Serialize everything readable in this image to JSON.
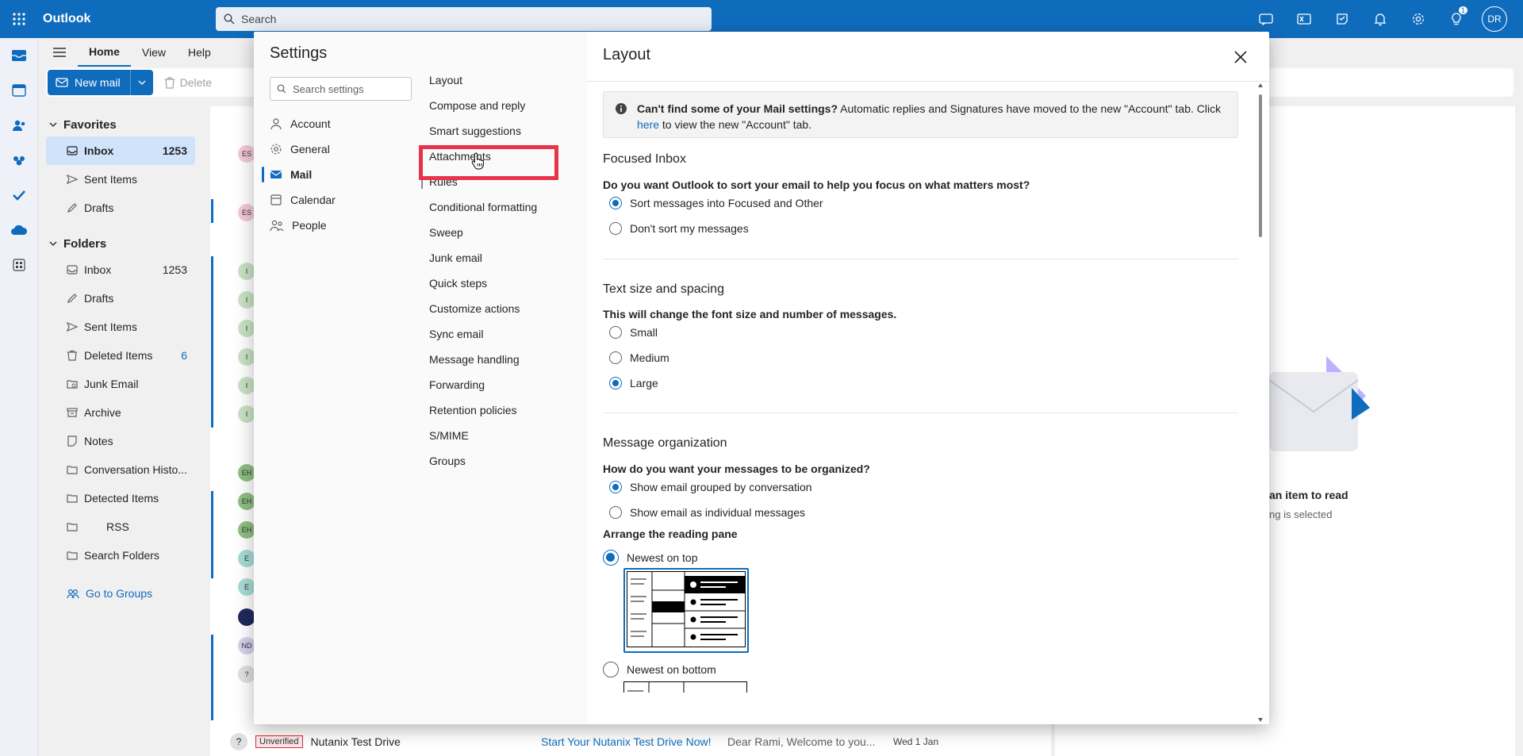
{
  "app": {
    "title": "Outlook",
    "search_placeholder": "Search",
    "user_initials": "DR",
    "tips_badge": "1"
  },
  "ribbon": {
    "tabs": [
      "Home",
      "View",
      "Help"
    ],
    "new_mail": "New mail",
    "delete": "Delete"
  },
  "folders": {
    "favorites_label": "Favorites",
    "favorites": [
      {
        "label": "Inbox",
        "count": "1253"
      },
      {
        "label": "Sent Items",
        "count": ""
      },
      {
        "label": "Drafts",
        "count": ""
      }
    ],
    "folders_label": "Folders",
    "items": [
      {
        "label": "Inbox",
        "count": "1253"
      },
      {
        "label": "Drafts",
        "count": ""
      },
      {
        "label": "Sent Items",
        "count": ""
      },
      {
        "label": "Deleted Items",
        "count": "6"
      },
      {
        "label": "Junk Email",
        "count": ""
      },
      {
        "label": "Archive",
        "count": ""
      },
      {
        "label": "Notes",
        "count": ""
      },
      {
        "label": "Conversation Histo...",
        "count": ""
      },
      {
        "label": "Detected Items",
        "count": ""
      },
      {
        "label": "RSS",
        "count": ""
      },
      {
        "label": "Search Folders",
        "count": ""
      }
    ],
    "go_to_groups": "Go to Groups"
  },
  "message_list": {
    "avatars": [
      "ES",
      "ES",
      "I",
      "I",
      "I",
      "I",
      "I",
      "I",
      "EH",
      "EH",
      "EH",
      "E",
      "E",
      "",
      "ND",
      "?",
      "?"
    ],
    "last_row": {
      "badge": "Unverified",
      "sender": "Nutanix Test Drive",
      "subject": "Start Your Nutanix Test Drive Now!",
      "preview": "Dear Rami, Welcome to you...",
      "date": "Wed 1 Jan"
    }
  },
  "reading_pane": {
    "title_partial": "an item to read",
    "subtitle_partial": "ng is selected"
  },
  "settings": {
    "title": "Settings",
    "search_placeholder": "Search settings",
    "categories": [
      {
        "label": "Account",
        "icon": "person-icon"
      },
      {
        "label": "General",
        "icon": "gear-icon"
      },
      {
        "label": "Mail",
        "icon": "mail-icon"
      },
      {
        "label": "Calendar",
        "icon": "calendar-icon"
      },
      {
        "label": "People",
        "icon": "people-icon"
      }
    ],
    "active_category": "Mail",
    "mail_subsections": [
      "Layout",
      "Compose and reply",
      "Smart suggestions",
      "Attachments",
      "Rules",
      "Conditional formatting",
      "Sweep",
      "Junk email",
      "Quick steps",
      "Customize actions",
      "Sync email",
      "Message handling",
      "Forwarding",
      "Retention policies",
      "S/MIME",
      "Groups"
    ],
    "active_subsection": "Rules",
    "content": {
      "header": "Layout",
      "info": {
        "bold": "Can't find some of your Mail settings?",
        "text": " Automatic replies and Signatures have moved to the new \"Account\" tab. Click",
        "link": "here",
        "text2": " to view the new \"Account\" tab."
      },
      "focused_inbox": {
        "title": "Focused Inbox",
        "question": "Do you want Outlook to sort your email to help you focus on what matters most?",
        "options": [
          {
            "label": "Sort messages into Focused and Other",
            "checked": true
          },
          {
            "label": "Don't sort my messages",
            "checked": false
          }
        ]
      },
      "text_size": {
        "title": "Text size and spacing",
        "question": "This will change the font size and number of messages.",
        "options": [
          {
            "label": "Small",
            "checked": false
          },
          {
            "label": "Medium",
            "checked": false
          },
          {
            "label": "Large",
            "checked": true
          }
        ]
      },
      "organization": {
        "title": "Message organization",
        "question": "How do you want your messages to be organized?",
        "options": [
          {
            "label": "Show email grouped by conversation",
            "checked": true
          },
          {
            "label": "Show email as individual messages",
            "checked": false
          }
        ],
        "arrange_label": "Arrange the reading pane",
        "arrange_options": [
          {
            "label": "Newest on top",
            "checked": true
          },
          {
            "label": "Newest on bottom",
            "checked": false
          }
        ]
      }
    }
  },
  "colors": {
    "brand": "#0f6cbd",
    "highlight": "#e8344a"
  }
}
